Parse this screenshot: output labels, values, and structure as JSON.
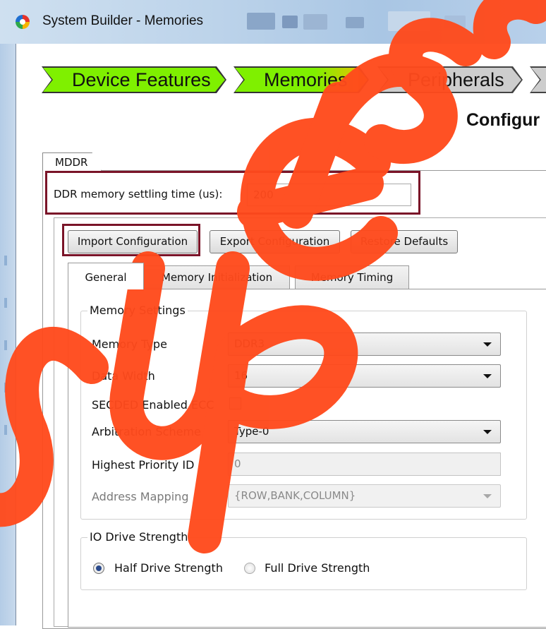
{
  "window": {
    "title": "System Builder - Memories"
  },
  "wizard": {
    "steps": [
      {
        "label": "Device Features",
        "state": "done"
      },
      {
        "label": "Memories",
        "state": "current"
      },
      {
        "label": "Peripherals",
        "state": "pending"
      }
    ],
    "page_heading": "Configur"
  },
  "mddr": {
    "tab_label": "MDDR",
    "settling_label": "DDR memory settling time (us):",
    "settling_value": "200",
    "buttons": {
      "import": "Import Configuration",
      "export": "Export Configuration",
      "restore": "Restore Defaults"
    },
    "subtabs": [
      "General",
      "Memory Initialization",
      "Memory Timing"
    ],
    "active_subtab": "General"
  },
  "memory_settings": {
    "title": "Memory Settings",
    "memory_type_label": "Memory Type",
    "memory_type_value": "DDR3",
    "data_width_label": "Data Width",
    "data_width_value": "16",
    "secded_label": "SECDED Enabled ECC",
    "secded_checked": false,
    "arbitration_label": "Arbitration Scheme",
    "arbitration_value": "Type-0",
    "priority_label": "Highest Priority ID",
    "priority_value": "0",
    "address_mapping_label": "Address Mapping",
    "address_mapping_value": "{ROW,BANK,COLUMN}"
  },
  "io_drive": {
    "title": "IO Drive Strength",
    "half_label": "Half Drive Strength",
    "full_label": "Full Drive Strength",
    "selected": "Half Drive Strength"
  },
  "colors": {
    "step_done": "#7ff000",
    "step_current": "#f0c000",
    "step_pending": "#cdcdcd",
    "highlight_box": "#7a1428",
    "watermark": "#ff4a1c"
  }
}
